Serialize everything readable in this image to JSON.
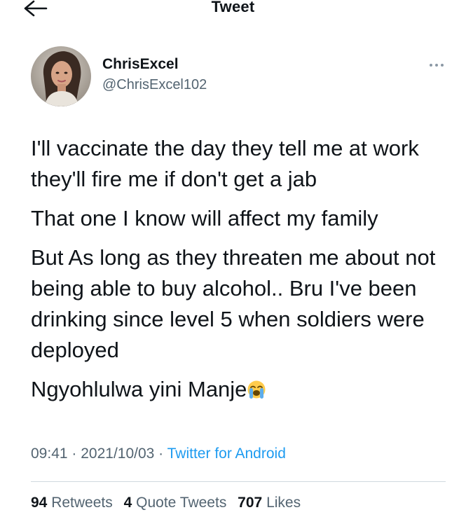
{
  "header": {
    "title": "Tweet",
    "back_icon": "arrow-left-icon"
  },
  "author": {
    "display_name": "ChrisExcel",
    "handle": "@ChrisExcel102",
    "avatar_icon": "profile-photo"
  },
  "more_icon": "more-horizontal-icon",
  "tweet": {
    "paragraphs": [
      "I'll vaccinate the day they tell me at work they'll fire me if don't get a jab",
      "That one I know will affect my family",
      "But As long as they threaten me about not being able to buy alcohol.. Bru I've been drinking since level 5 when soldiers were deployed",
      "Ngyohlulwa yini Manje"
    ],
    "emoji": "loudly-crying-face-emoji"
  },
  "meta": {
    "time": "09:41",
    "separator1": " · ",
    "date": "2021/10/03",
    "separator2": " · ",
    "source": "Twitter for Android"
  },
  "stats": {
    "retweets_count": "94",
    "retweets_label": "Retweets",
    "quotes_count": "4",
    "quotes_label": "Quote Tweets",
    "likes_count": "707",
    "likes_label": "Likes"
  },
  "colors": {
    "text": "#0f1419",
    "secondary": "#536471",
    "link": "#1d9bf0",
    "divider": "#cfd9de"
  }
}
